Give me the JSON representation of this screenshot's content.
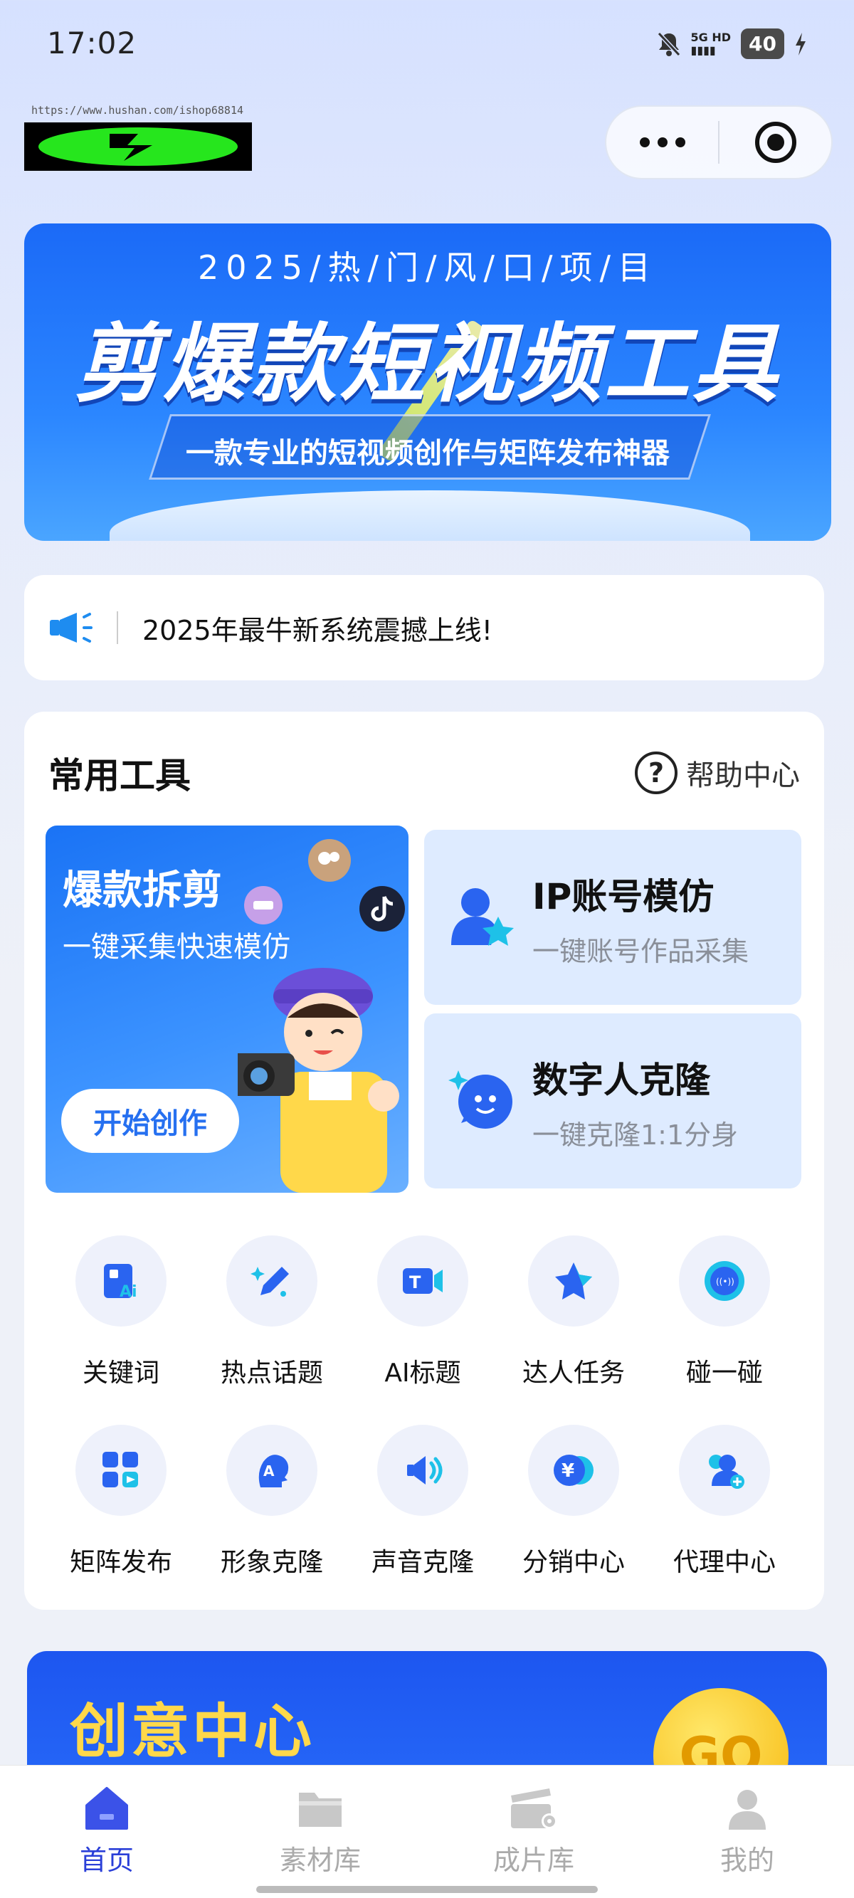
{
  "status_bar": {
    "time": "17:02",
    "network_top": "5G HD",
    "network_bottom": "▮▮▮▮",
    "battery": "40"
  },
  "logo": {
    "url_text": "https://www.hushan.com/ishop68814"
  },
  "banner": {
    "subtitle": "2025/热/门/风/口/项/目",
    "title": "剪爆款短视频工具",
    "slogan": "一款专业的短视频创作与矩阵发布神器"
  },
  "notice": {
    "text": "2025年最牛新系统震撼上线!"
  },
  "tools": {
    "title": "常用工具",
    "help_label": "帮助中心",
    "big_card": {
      "title": "爆款拆剪",
      "subtitle": "一键采集快速模仿",
      "button": "开始创作"
    },
    "side_cards": [
      {
        "title": "IP账号模仿",
        "subtitle": "一键账号作品采集"
      },
      {
        "title": "数字人克隆",
        "subtitle": "一键克隆1:1分身"
      }
    ],
    "grid": [
      {
        "label": "关键词",
        "icon": "ai-card-icon"
      },
      {
        "label": "热点话题",
        "icon": "pencil-sparkle-icon"
      },
      {
        "label": "AI标题",
        "icon": "text-video-icon"
      },
      {
        "label": "达人任务",
        "icon": "star-icon"
      },
      {
        "label": "碰一碰",
        "icon": "nfc-icon"
      },
      {
        "label": "矩阵发布",
        "icon": "grid-publish-icon"
      },
      {
        "label": "形象克隆",
        "icon": "avatar-clone-icon"
      },
      {
        "label": "声音克隆",
        "icon": "speaker-icon"
      },
      {
        "label": "分销中心",
        "icon": "coin-icon"
      },
      {
        "label": "代理中心",
        "icon": "users-add-icon"
      }
    ]
  },
  "creative": {
    "title": "创意中心",
    "go_label": "GO"
  },
  "tabbar": {
    "items": [
      {
        "label": "首页",
        "icon": "home-icon",
        "active": true
      },
      {
        "label": "素材库",
        "icon": "folder-icon",
        "active": false
      },
      {
        "label": "成片库",
        "icon": "clapper-icon",
        "active": false
      },
      {
        "label": "我的",
        "icon": "user-icon",
        "active": false
      }
    ]
  },
  "colors": {
    "accent": "#2a3fd8",
    "primary_blue": "#2670f0",
    "icon_blue": "#1e8cf0"
  }
}
